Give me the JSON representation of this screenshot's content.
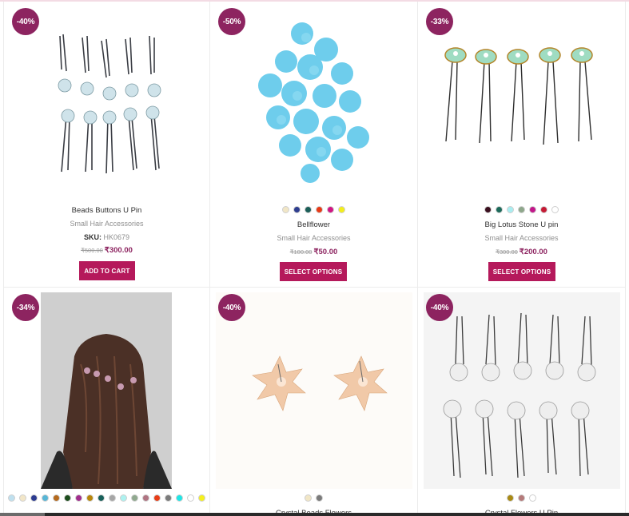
{
  "colors": {
    "badge": "#8d2460",
    "button": "#b5195b",
    "price": "#8d2460"
  },
  "products": [
    {
      "badge": "-40%",
      "title": "Beads Buttons U Pin",
      "category": "Small Hair Accessories",
      "sku_label": "SKU:",
      "sku_value": "HK0679",
      "old_price": "₹500.00",
      "price": "₹300.00",
      "button": "ADD TO CART",
      "image_icon": "hair-pin-pearl-image",
      "swatches": []
    },
    {
      "badge": "-50%",
      "title": "Bellflower",
      "category": "Small Hair Accessories",
      "old_price": "₹100.00",
      "price": "₹50.00",
      "button": "SELECT OPTIONS",
      "image_icon": "blue-flower-beads-image",
      "swatches": [
        "#f1e6c6",
        "#2e3e8f",
        "#1b5e58",
        "#e83a16",
        "#d11583",
        "#f3ee1c"
      ]
    },
    {
      "badge": "-33%",
      "title": "Big Lotus Stone U pin",
      "category": "Small Hair Accessories",
      "old_price": "₹300.00",
      "price": "₹200.00",
      "button": "SELECT OPTIONS",
      "image_icon": "lotus-stone-pin-image",
      "swatches": [
        "#3a0f1e",
        "#1c6a5a",
        "#a9edf0",
        "#8ea78b",
        "#c2178a",
        "#c51a34",
        "#ffffff"
      ]
    },
    {
      "badge": "-34%",
      "image_icon": "hair-model-image",
      "swatches": [
        "#bfe0ef",
        "#f2e6c8",
        "#2d3c91",
        "#58b6d6",
        "#b56a1e",
        "#1d4d1d",
        "#a12d8c",
        "#b8860b",
        "#17605a",
        "#a6a6a6",
        "#aef2f0",
        "#90a98f",
        "#b07482",
        "#e83d17",
        "#7b7b7b",
        "#1ee6e6",
        "#ffffff",
        "#f5f01e"
      ]
    },
    {
      "badge": "-40%",
      "title": "Crystal Beads Flowers",
      "image_icon": "crystal-bead-flowers-image",
      "swatches": [
        "#f1e6c6",
        "#7b7b7b"
      ]
    },
    {
      "badge": "-40%",
      "title": "Crystal Flowers U Pin",
      "image_icon": "crystal-flower-pins-image",
      "swatches": [
        "#a98a14",
        "#b57a7a",
        "#ffffff"
      ]
    }
  ]
}
